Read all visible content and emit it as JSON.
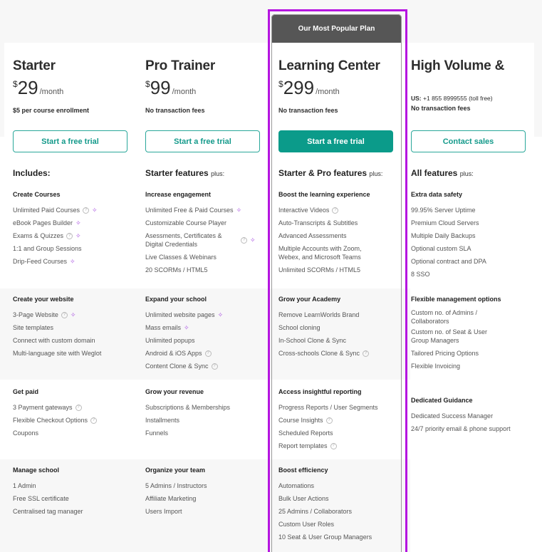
{
  "popular_badge": "Our Most Popular Plan",
  "colors": {
    "accent": "#0b9b8a",
    "highlight": "#b515e0",
    "sparkle": "#a64ce0",
    "badge_bg": "#565656"
  },
  "plans": [
    {
      "name": "Starter",
      "currency": "$",
      "price": "29",
      "period": "/month",
      "note": "$5 per course enrollment",
      "cta": "Start a free trial",
      "includes_title": "Includes:",
      "includes_suffix": "",
      "sections": [
        {
          "title": "Create Courses",
          "items": [
            {
              "text": "Unlimited Paid Courses",
              "help": true,
              "sparkle": true
            },
            {
              "text": "eBook Pages Builder",
              "help": false,
              "sparkle": true
            },
            {
              "text": "Exams & Quizzes",
              "help": true,
              "sparkle": true
            },
            {
              "text": "1:1 and Group Sessions",
              "help": false,
              "sparkle": false
            },
            {
              "text": "Drip-Feed Courses",
              "help": false,
              "sparkle": true
            }
          ]
        },
        {
          "title": "Create your website",
          "items": [
            {
              "text": "3-Page Website",
              "help": true,
              "sparkle": true
            },
            {
              "text": "Site templates",
              "help": false,
              "sparkle": false
            },
            {
              "text": "Connect with custom domain",
              "help": false,
              "sparkle": false
            },
            {
              "text": "Multi-language site with Weglot",
              "help": false,
              "sparkle": false
            }
          ]
        },
        {
          "title": "Get paid",
          "items": [
            {
              "text": "3 Payment gateways",
              "help": true,
              "sparkle": false
            },
            {
              "text": "Flexible Checkout Options",
              "help": true,
              "sparkle": false
            },
            {
              "text": "Coupons",
              "help": false,
              "sparkle": false
            }
          ]
        },
        {
          "title": "Manage school",
          "items": [
            {
              "text": "1 Admin",
              "help": false,
              "sparkle": false
            },
            {
              "text": "Free SSL certificate",
              "help": false,
              "sparkle": false
            },
            {
              "text": "Centralised tag manager",
              "help": false,
              "sparkle": false
            }
          ]
        }
      ]
    },
    {
      "name": "Pro Trainer",
      "currency": "$",
      "price": "99",
      "period": "/month",
      "note": "No transaction fees",
      "cta": "Start a free trial",
      "includes_title": "Starter features",
      "includes_suffix": "plus:",
      "sections": [
        {
          "title": "Increase engagement",
          "items": [
            {
              "text": "Unlimited Free & Paid Courses",
              "help": false,
              "sparkle": true
            },
            {
              "text": "Customizable Course Player",
              "help": false,
              "sparkle": false
            },
            {
              "text": "Asessments, Certificates & Digital Credentials",
              "help": true,
              "sparkle": true,
              "wrap": true
            },
            {
              "text": "Live Classes & Webinars",
              "help": false,
              "sparkle": false
            },
            {
              "text": "20 SCORMs / HTML5",
              "help": false,
              "sparkle": false
            }
          ]
        },
        {
          "title": "Expand your school",
          "items": [
            {
              "text": "Unlimited website pages",
              "help": false,
              "sparkle": true
            },
            {
              "text": "Mass emails",
              "help": false,
              "sparkle": true
            },
            {
              "text": "Unlimited popups",
              "help": false,
              "sparkle": false
            },
            {
              "text": "Android & iOS Apps",
              "help": true,
              "sparkle": false
            },
            {
              "text": "Content Clone & Sync",
              "help": true,
              "sparkle": false
            }
          ]
        },
        {
          "title": "Grow your revenue",
          "items": [
            {
              "text": "Subscriptions & Memberships",
              "help": false,
              "sparkle": false
            },
            {
              "text": "Installments",
              "help": false,
              "sparkle": false
            },
            {
              "text": "Funnels",
              "help": false,
              "sparkle": false
            }
          ]
        },
        {
          "title": "Organize your team",
          "items": [
            {
              "text": "5 Admins / Instructors",
              "help": false,
              "sparkle": false
            },
            {
              "text": "Affiliate Marketing",
              "help": false,
              "sparkle": false
            },
            {
              "text": "Users Import",
              "help": false,
              "sparkle": false
            }
          ]
        }
      ]
    },
    {
      "name": "Learning Center",
      "currency": "$",
      "price": "299",
      "period": "/month",
      "note": "No transaction fees",
      "cta": "Start a free trial",
      "includes_title": "Starter & Pro features",
      "includes_suffix": "plus:",
      "sections": [
        {
          "title": "Boost the learning experience",
          "items": [
            {
              "text": "Interactive Videos",
              "help": true,
              "sparkle": false
            },
            {
              "text": "Auto-Transcripts & Subtitles",
              "help": false,
              "sparkle": false
            },
            {
              "text": "Advanced Assessments",
              "help": false,
              "sparkle": false
            },
            {
              "text": "Multiple Accounts with Zoom, Webex, and Microsoft Teams",
              "help": false,
              "sparkle": false,
              "wrap": true
            },
            {
              "text": "Unlimited SCORMs / HTML5",
              "help": false,
              "sparkle": false
            }
          ]
        },
        {
          "title": "Grow your Academy",
          "items": [
            {
              "text": "Remove LearnWorlds Brand",
              "help": false,
              "sparkle": false
            },
            {
              "text": "School cloning",
              "help": false,
              "sparkle": false
            },
            {
              "text": "In-School Clone & Sync",
              "help": false,
              "sparkle": false
            },
            {
              "text": "Cross-schools Clone & Sync",
              "help": true,
              "sparkle": false
            }
          ]
        },
        {
          "title": "Access insightful reporting",
          "items": [
            {
              "text": "Progress Reports / User Segments",
              "help": false,
              "sparkle": false
            },
            {
              "text": "Course Insights",
              "help": true,
              "sparkle": false
            },
            {
              "text": "Scheduled Reports",
              "help": false,
              "sparkle": false
            },
            {
              "text": "Report templates",
              "help": true,
              "sparkle": false
            }
          ]
        },
        {
          "title": "Boost efficiency",
          "items": [
            {
              "text": "Automations",
              "help": false,
              "sparkle": false
            },
            {
              "text": "Bulk User Actions",
              "help": false,
              "sparkle": false
            },
            {
              "text": "25 Admins / Collaborators",
              "help": false,
              "sparkle": false
            },
            {
              "text": "Custom User Roles",
              "help": false,
              "sparkle": false
            },
            {
              "text": "10 Seat & User Group Managers",
              "help": false,
              "sparkle": false
            }
          ]
        }
      ]
    },
    {
      "name": "High Volume &",
      "phone_label": "US:",
      "phone": "+1 855 8999555 (toll free)",
      "note": "No transaction fees",
      "cta": "Contact sales",
      "includes_title": "All features",
      "includes_suffix": "plus:",
      "sections": [
        {
          "title": "Extra data safety",
          "items": [
            {
              "text": "99.95% Server Uptime",
              "help": false,
              "sparkle": false
            },
            {
              "text": "Premium Cloud Servers",
              "help": false,
              "sparkle": false
            },
            {
              "text": "Multiple Daily Backups",
              "help": false,
              "sparkle": false
            },
            {
              "text": "Optional custom SLA",
              "help": false,
              "sparkle": false
            },
            {
              "text": "Optional contract and DPA",
              "help": false,
              "sparkle": false
            },
            {
              "text": "8 SSO",
              "help": false,
              "sparkle": false
            }
          ]
        },
        {
          "title": "Flexible management options",
          "items": [
            {
              "text": "Custom no. of Admins / Collaborators",
              "help": false,
              "sparkle": false,
              "wrap": true
            },
            {
              "text": "Custom no. of Seat & User Group Managers",
              "help": false,
              "sparkle": false,
              "wrap": true
            },
            {
              "text": "Tailored Pricing Options",
              "help": false,
              "sparkle": false
            },
            {
              "text": "Flexible Invoicing",
              "help": false,
              "sparkle": false
            }
          ]
        },
        {
          "title": "Dedicated Guidance",
          "items": [
            {
              "text": "Dedicated Success Manager",
              "help": false,
              "sparkle": false
            },
            {
              "text": "24/7 priority email & phone support",
              "help": false,
              "sparkle": false
            }
          ]
        }
      ]
    }
  ]
}
